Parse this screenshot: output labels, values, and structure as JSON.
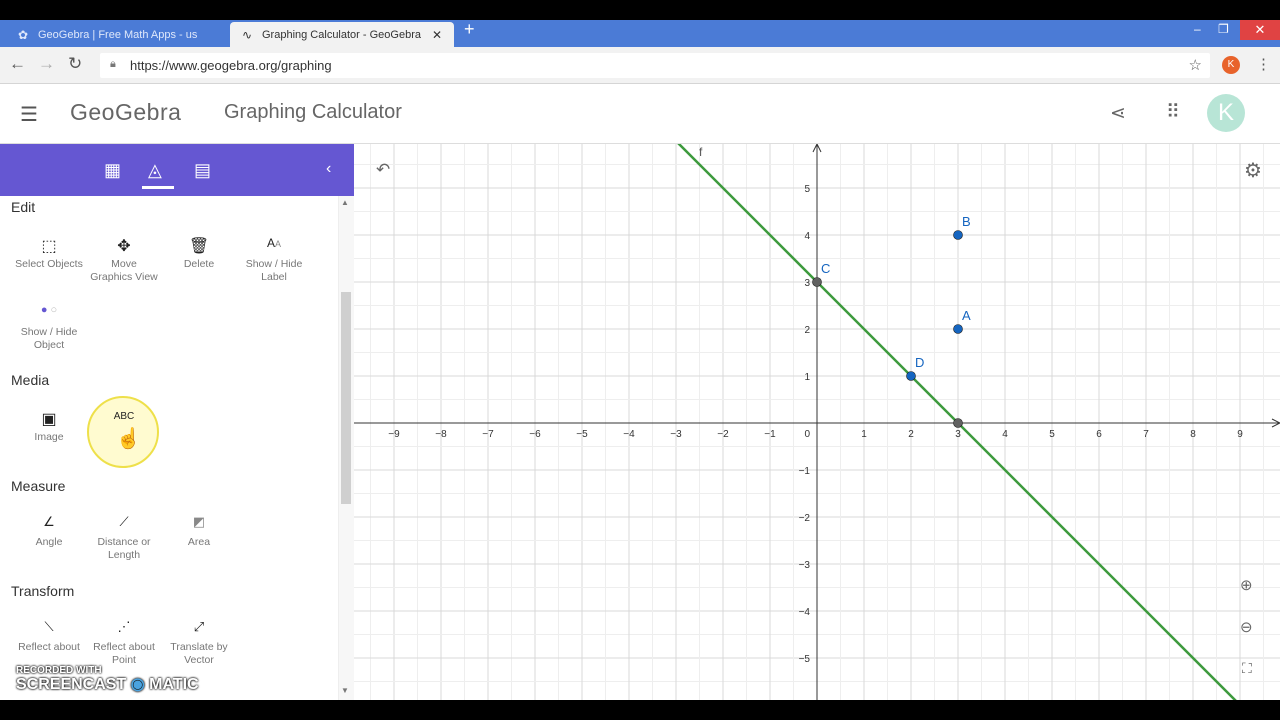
{
  "browser": {
    "tabs": [
      {
        "title": "GeoGebra | Free Math Apps - us",
        "icon": "geogebra-icon",
        "active": false
      },
      {
        "title": "Graphing Calculator - GeoGebra",
        "icon": "graph-icon",
        "active": true
      }
    ],
    "url": "https://www.geogebra.org/graphing",
    "profile_initial": "K"
  },
  "app": {
    "logo": "GeoGebra",
    "title": "Graphing Calculator",
    "avatar_initial": "K"
  },
  "sections": {
    "edit": "Edit",
    "media": "Media",
    "measure": "Measure",
    "transform": "Transform"
  },
  "tools": {
    "select_objects": [
      "Select Objects",
      ""
    ],
    "move_graphics": [
      "Move",
      "Graphics View"
    ],
    "delete": [
      "Delete",
      ""
    ],
    "show_hide_label": [
      "Show / Hide",
      "Label"
    ],
    "show_hide_object": [
      "Show / Hide",
      "Object"
    ],
    "image": [
      "Image",
      ""
    ],
    "text": [
      "ABC",
      ""
    ],
    "angle": [
      "Angle",
      ""
    ],
    "distance": [
      "Distance or",
      "Length"
    ],
    "area": [
      "Area",
      ""
    ],
    "reflect_line": [
      "Reflect about",
      ""
    ],
    "reflect_point": [
      "Reflect about",
      "Point"
    ],
    "translate_vector": [
      "Translate by",
      "Vector"
    ]
  },
  "watermark": {
    "line1": "RECORDED WITH",
    "line2": "SCREENCAST",
    "line3": "MATIC"
  },
  "graph": {
    "xticks": [
      -9,
      -8,
      -7,
      -6,
      -5,
      -4,
      -3,
      -2,
      -1,
      1,
      2,
      3,
      4,
      5,
      6,
      7,
      8,
      9
    ],
    "yticks": [
      5,
      4,
      3,
      2,
      1,
      -1,
      -2,
      -3,
      -4,
      -5
    ],
    "origin_label": "0",
    "xrange": [
      -9.8,
      9.9
    ],
    "yrange": [
      -5.9,
      5.9
    ],
    "line": {
      "name": "f",
      "slope": -1,
      "intercept": 3,
      "color": "#3d9a3d"
    },
    "points": [
      {
        "name": "A",
        "x": 3,
        "y": 2,
        "color": "#1565c0"
      },
      {
        "name": "B",
        "x": 3,
        "y": 4,
        "color": "#1565c0"
      },
      {
        "name": "C",
        "x": 0,
        "y": 3,
        "color": "#616161"
      },
      {
        "name": "D",
        "x": 2,
        "y": 1,
        "color": "#1565c0"
      },
      {
        "name": "",
        "x": 3,
        "y": 0,
        "color": "#616161"
      }
    ]
  }
}
